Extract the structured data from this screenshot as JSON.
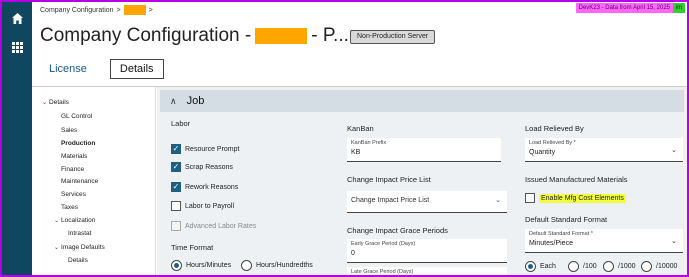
{
  "breadcrumb": {
    "root": "Company Configuration",
    "sep": ">"
  },
  "banner": {
    "text": "DevK23 - Data from April 15, 2025",
    "flag": "im"
  },
  "page": {
    "title_prefix": "Company Configuration -",
    "title_suffix": "- P..."
  },
  "server_badge": "Non-Production Server",
  "tabs": [
    "License",
    "Details"
  ],
  "sidenav": [
    {
      "label": "Details",
      "chev": "⌄"
    },
    {
      "label": "GL Control"
    },
    {
      "label": "Sales"
    },
    {
      "label": "Production"
    },
    {
      "label": "Materials"
    },
    {
      "label": "Finance"
    },
    {
      "label": "Maintenance"
    },
    {
      "label": "Services"
    },
    {
      "label": "Taxes"
    },
    {
      "label": "Localization",
      "chev": "⌄"
    },
    {
      "label": "Intrastat"
    },
    {
      "label": "Image Defaults",
      "chev": "⌄"
    },
    {
      "label": "Details"
    }
  ],
  "section": {
    "caret": "∧",
    "label": "Job"
  },
  "labor": {
    "title": "Labor",
    "options": [
      {
        "label": "Resource Prompt",
        "checked": true
      },
      {
        "label": "Scrap Reasons",
        "checked": true
      },
      {
        "label": "Rework Reasons",
        "checked": true
      },
      {
        "label": "Labor to Payroll",
        "checked": false
      },
      {
        "label": "Advanced Labor Rates",
        "checked": false,
        "disabled": true
      }
    ],
    "time_format": {
      "title": "Time Format",
      "options": [
        {
          "label": "Hours/Minutes",
          "selected": true
        },
        {
          "label": "Hours/Hundredths",
          "selected": false
        }
      ]
    }
  },
  "kanban": {
    "title": "KanBan",
    "prefix": {
      "label": "KanBan Prefix",
      "value": "KB"
    },
    "change_impact_price_list": {
      "title": "Change Impact Price List",
      "value": "Change Impact Price List"
    },
    "grace_periods": {
      "title": "Change Impact Grace Periods",
      "early": {
        "label": "Early Grace Period (Days)",
        "value": "0"
      },
      "late": {
        "label": "Late Grace Period (Days)"
      }
    }
  },
  "load_relieved": {
    "title": "Load Relieved By",
    "field": {
      "label": "Load Relieved By *",
      "value": "Quantity"
    },
    "issued_title": "Issued Manufactured Materials",
    "enable_mfg": {
      "label": "Enable Mfg Cost Elements",
      "checked": false
    },
    "default_std_format": {
      "title": "Default Standard Format",
      "field": {
        "label": "Default Standard Format *",
        "value": "Minutes/Piece"
      },
      "options": [
        {
          "label": "Each",
          "selected": true
        },
        {
          "label": "/100",
          "selected": false
        },
        {
          "label": "/1000",
          "selected": false
        },
        {
          "label": "/10000",
          "selected": false
        }
      ]
    }
  },
  "icons": {
    "home": "home-icon",
    "apps": "grid-icon",
    "dropdown": "chevron-down-icon"
  },
  "colors": {
    "rail": "#0f4761",
    "accent": "#1f5f85",
    "banner": "#ff66ff",
    "redaction": "#ffa500",
    "highlight": "#f2ff3d"
  }
}
